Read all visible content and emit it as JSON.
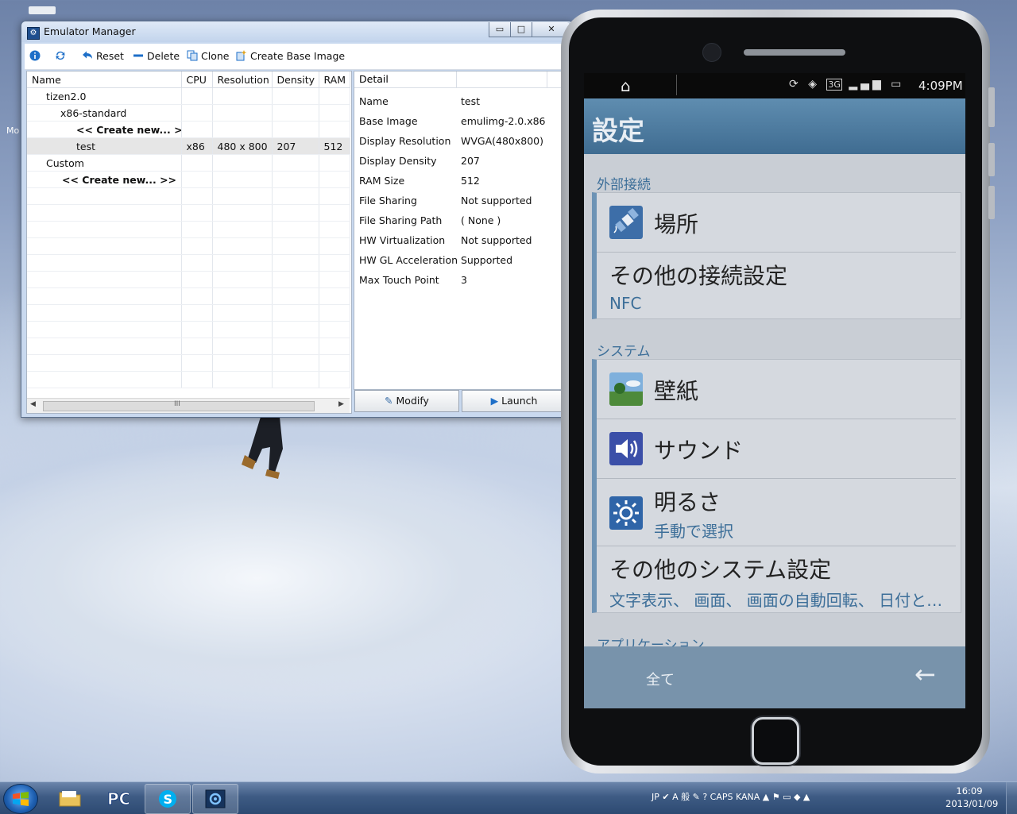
{
  "desktop": {
    "left_label_fragment": "Mo"
  },
  "emulator_manager": {
    "title": "Emulator Manager",
    "window_buttons": {
      "minimize": "▭",
      "maximize": "□",
      "close": "✕"
    },
    "toolbar": {
      "reset": "Reset",
      "delete": "Delete",
      "clone": "Clone",
      "create_base_image": "Create Base Image"
    },
    "columns": [
      "Name",
      "CPU",
      "Resolution",
      "Density",
      "RAM"
    ],
    "rows": [
      {
        "name": "tizen2.0",
        "cpu": "",
        "resolution": "",
        "density": "",
        "ram": ""
      },
      {
        "name": "x86-standard",
        "cpu": "",
        "resolution": "",
        "density": "",
        "ram": ""
      },
      {
        "name": "<< Create new... >>",
        "cpu": "",
        "resolution": "",
        "density": "",
        "ram": ""
      },
      {
        "name": "test",
        "cpu": "x86",
        "resolution": "480 x 800",
        "density": "207",
        "ram": "512"
      },
      {
        "name": "Custom",
        "cpu": "",
        "resolution": "",
        "density": "",
        "ram": ""
      },
      {
        "name": "<< Create new... >>",
        "cpu": "",
        "resolution": "",
        "density": "",
        "ram": ""
      }
    ],
    "scrollbar_grip": "III",
    "detail": {
      "header": "Detail",
      "items": [
        {
          "key": "Name",
          "value": "test"
        },
        {
          "key": "Base Image",
          "value": "emulimg-2.0.x86"
        },
        {
          "key": "Display Resolution",
          "value": "WVGA(480x800)"
        },
        {
          "key": "Display Density",
          "value": "207"
        },
        {
          "key": "RAM Size",
          "value": "512"
        },
        {
          "key": "File Sharing",
          "value": "Not supported"
        },
        {
          "key": "File Sharing Path",
          "value": "( None )"
        },
        {
          "key": "HW Virtualization",
          "value": "Not supported"
        },
        {
          "key": "HW GL Acceleration",
          "value": "Supported"
        },
        {
          "key": "Max Touch Point",
          "value": "3"
        }
      ]
    },
    "buttons": {
      "modify": "Modify",
      "launch": "Launch"
    }
  },
  "phone": {
    "status": {
      "network": "3G",
      "time": "4:09PM"
    },
    "header_title": "設定",
    "sections": {
      "external": "外部接続",
      "system": "システム",
      "applications": "アプリケーション"
    },
    "items": {
      "location": "場所",
      "other_connections": "その他の接続設定",
      "other_connections_sub": "NFC",
      "wallpaper": "壁紙",
      "sound": "サウンド",
      "brightness": "明るさ",
      "brightness_sub": "手動で選択",
      "other_system": "その他のシステム設定",
      "other_system_sub": "文字表示、 画面、 画面の自動回転、 日付と…"
    },
    "bottom": {
      "all": "全て",
      "back": "←"
    }
  },
  "taskbar": {
    "pinned": [
      "file-explorer",
      "pc-app",
      "skype",
      "emulator-app"
    ],
    "tray_text": "JP  ✔  A 般  ✎  ?  CAPS KANA  ▲  ⚑  ▭  ◆  ▲",
    "clock_time": "16:09",
    "clock_date": "2013/01/09"
  },
  "colors": {
    "phone_header": "#4a7aa0",
    "accent_blue": "#3d6f99",
    "taskbar": "#3e5b84"
  }
}
